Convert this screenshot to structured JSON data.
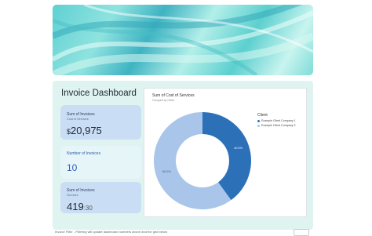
{
  "dashboard": {
    "title": "Invoice Dashboard",
    "cards": [
      {
        "label": "Sum of Invoices",
        "sub": "Cost of Services",
        "value_prefix": "$",
        "value": "20,975"
      },
      {
        "label": "Number of Invoices",
        "value": "10"
      },
      {
        "label": "Sum of Invoices",
        "sub": "Services",
        "value_main": "419",
        "value_suffix": ":30"
      }
    ]
  },
  "chart": {
    "title": "Sum of Cost of Services",
    "subtitle": "Grouped by Client",
    "legend_title": "Client",
    "legend": [
      "Example Client Company 1",
      "Example Client Company 2"
    ]
  },
  "chart_data": {
    "type": "pie",
    "title": "Sum of Cost of Services",
    "categories": [
      "Example Client Company 1",
      "Example Client Company 2"
    ],
    "values": [
      40.0,
      60.0
    ],
    "labels": [
      "40.0%",
      "60.0%"
    ],
    "colors": [
      "#2c70b8",
      "#a9c5ea"
    ],
    "legend": "right"
  },
  "footer": {
    "text": "Invoice Filter - Filtering will update dashboard numbers above and the grid below"
  }
}
